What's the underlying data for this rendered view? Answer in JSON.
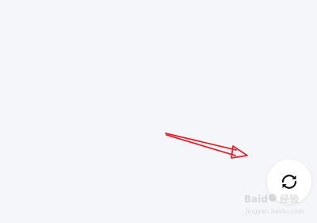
{
  "screen": {
    "background_color": "#f5f6fa"
  },
  "annotation": {
    "arrow_color": "#e0242f"
  },
  "refresh_button": {
    "icon": "refresh-icon",
    "icon_color": "#111111",
    "background_color": "#ffffff"
  },
  "watermark": {
    "text": "Baidu经验",
    "url": "jingyan.baidu.com",
    "color": "#8c8c8c"
  }
}
